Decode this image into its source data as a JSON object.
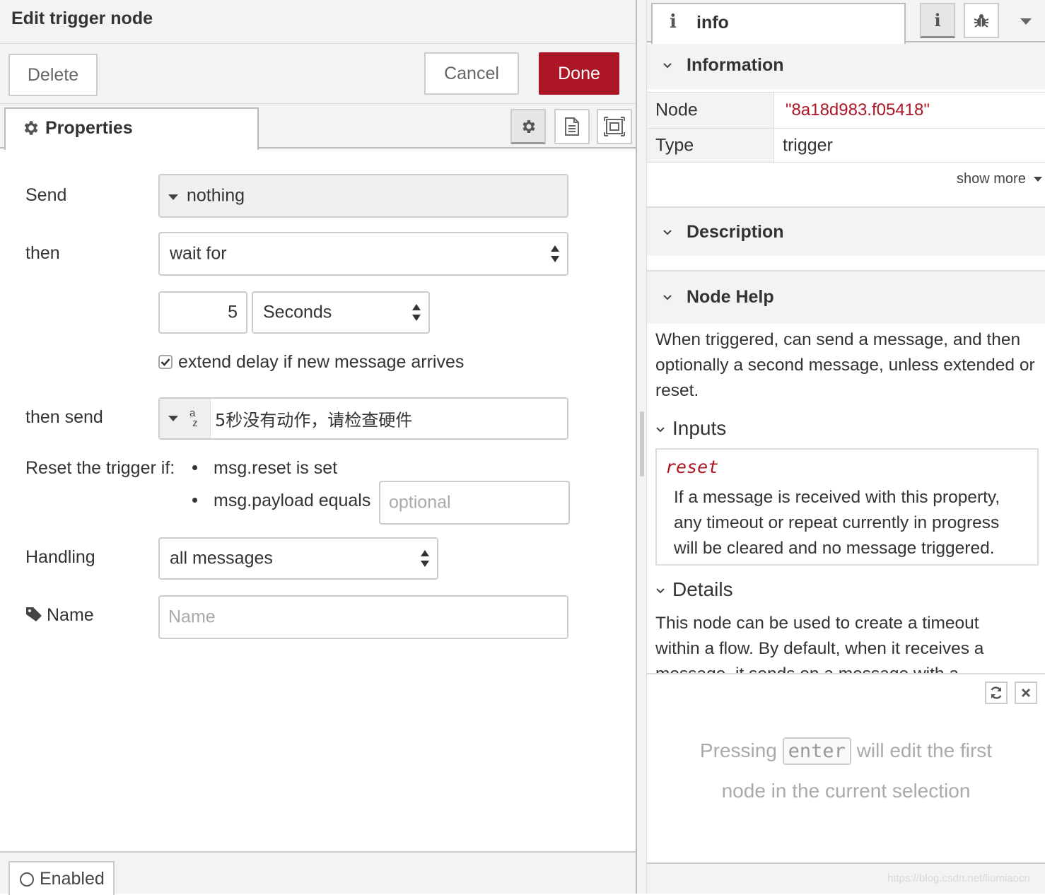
{
  "editor": {
    "title": "Edit trigger node",
    "delete_label": "Delete",
    "cancel_label": "Cancel",
    "done_label": "Done",
    "tab_properties": "Properties",
    "done_color": "#ad1625"
  },
  "form": {
    "send_label": "Send",
    "send_value": "nothing",
    "then_label": "then",
    "then_value": "wait for",
    "delay_value": "5",
    "delay_units": "Seconds",
    "extend_label": "extend delay if new message arrives",
    "extend_checked": true,
    "then_send_label": "then send",
    "then_send_type_icon": "az",
    "then_send_value": "5秒没有动作，请检查硬件",
    "reset_label": "Reset the trigger if:",
    "reset_opt1": "msg.reset is set",
    "reset_opt2": "msg.payload equals",
    "reset_payload_placeholder": "optional",
    "handling_label": "Handling",
    "handling_value": "all messages",
    "name_label": "Name",
    "name_placeholder": "Name"
  },
  "footer": {
    "enabled_label": "Enabled"
  },
  "sidebar": {
    "tab_label": "info",
    "info_button": "i",
    "information_header": "Information",
    "node_key": "Node",
    "node_value": "\"8a18d983.f05418\"",
    "type_key": "Type",
    "type_value": "trigger",
    "show_more": "show more",
    "description_header": "Description",
    "node_help_header": "Node Help",
    "help_intro": "When triggered, can send a message, and then optionally a second message, unless extended or reset.",
    "inputs_header": "Inputs",
    "input_reset_name": "reset",
    "input_reset_desc": "If a message is received with this property, any timeout or repeat currently in progress will be cleared and no message triggered.",
    "details_header": "Details",
    "details_text": "This node can be used to create a timeout within a flow. By default, when it receives a message, it sends on a message with a",
    "tip_before": "Pressing",
    "tip_key": "enter",
    "tip_after": "will edit the first",
    "tip_line2": "node in the current selection",
    "node_id_color": "#ad1625"
  },
  "watermark": "https://blog.csdn.net/liumiaocn"
}
